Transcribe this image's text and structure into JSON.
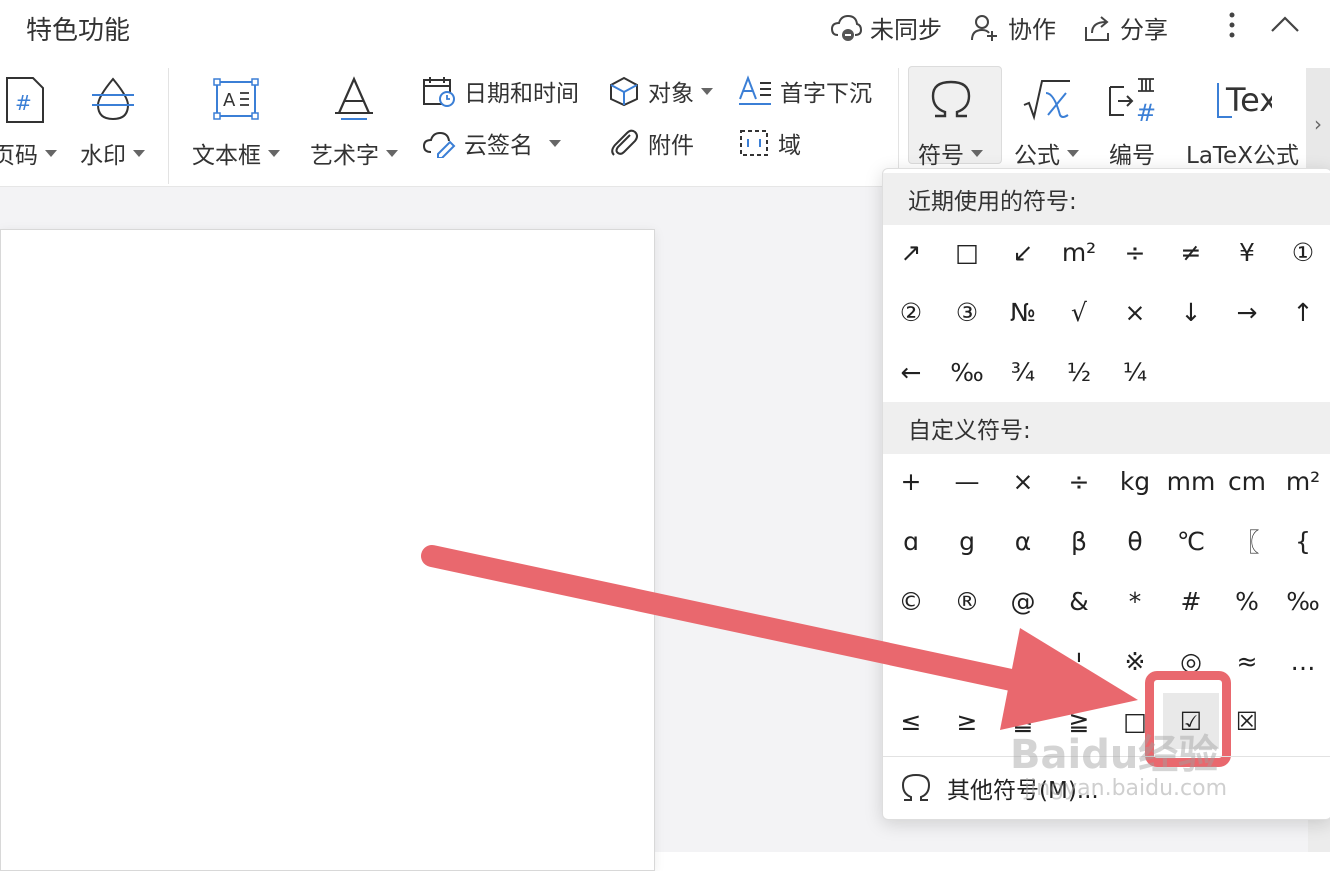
{
  "app": {
    "title": "特色功能"
  },
  "top_actions": {
    "sync": "未同步",
    "collaborate": "协作",
    "share": "分享"
  },
  "ribbon": {
    "page_number": "页码",
    "watermark": "水印",
    "text_box": "文本框",
    "word_art": "艺术字",
    "date_time": "日期和时间",
    "cloud_sign": "云签名",
    "object": "对象",
    "attachment": "附件",
    "drop_cap": "首字下沉",
    "field": "域",
    "symbol": "符号",
    "formula": "公式",
    "numbering": "编号",
    "latex_formula": "LaTeX公式",
    "latex_icon_text": "Tex"
  },
  "symbol_menu": {
    "recent_title": "近期使用的符号:",
    "recent_symbols": [
      "↗",
      "□",
      "↙",
      "m²",
      "÷",
      "≠",
      "¥",
      "①",
      "②",
      "③",
      "№",
      "√",
      "×",
      "↓",
      "→",
      "↑",
      "←",
      "‰",
      "¾",
      "½",
      "¼"
    ],
    "custom_title": "自定义符号:",
    "custom_symbols": [
      "+",
      "—",
      "×",
      "÷",
      "kg",
      "mm",
      "cm",
      "m²",
      "ɑ",
      "g",
      "α",
      "β",
      "θ",
      "℃",
      "〖",
      "{",
      "©",
      "®",
      "@",
      "&",
      "*",
      "#",
      "%",
      "‰",
      "",
      "",
      "§",
      "¦",
      "※",
      "◎",
      "≈",
      "…",
      "≤",
      "≥",
      "≦",
      "≧",
      "□",
      "☑",
      "☒"
    ],
    "selected_symbol": "☑",
    "more_label": "其他符号(M)..."
  },
  "watermark": {
    "brand": "Baidu经验",
    "url": "jingyan.baidu.com"
  },
  "colors": {
    "highlight": "#e9686e",
    "accent": "#3b7fd6"
  }
}
